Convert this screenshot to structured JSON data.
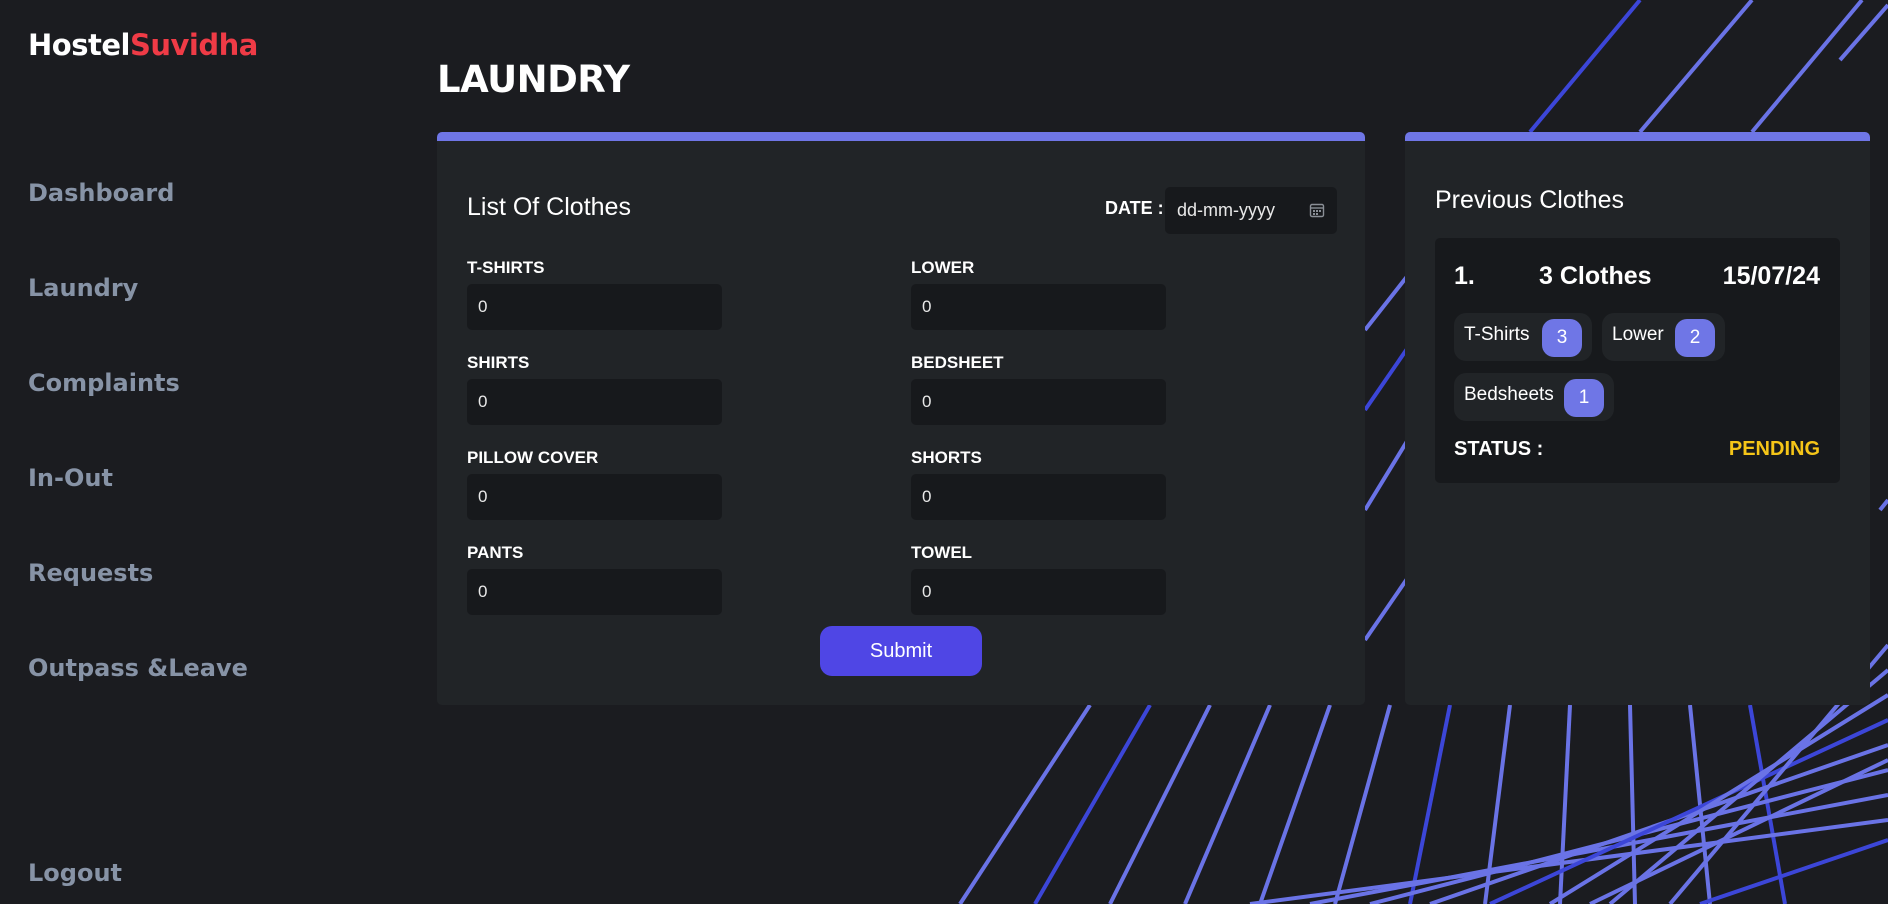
{
  "brand": {
    "part1": "Hostel",
    "part2": "Suvidha"
  },
  "nav": {
    "dashboard": "Dashboard",
    "laundry": "Laundry",
    "complaints": "Complaints",
    "in_out": "In-Out",
    "requests": "Requests",
    "outpass": "Outpass &Leave",
    "logout": "Logout"
  },
  "page_title": "LAUNDRY",
  "form": {
    "title": "List Of Clothes",
    "date_label": "DATE :",
    "date_placeholder": "dd-mm-yyyy",
    "fields": {
      "tshirts": {
        "label": "T-SHIRTS",
        "value": "0"
      },
      "lower": {
        "label": "LOWER",
        "value": "0"
      },
      "shirts": {
        "label": "SHIRTS",
        "value": "0"
      },
      "bedsheet": {
        "label": "BEDSHEET",
        "value": "0"
      },
      "pillow_cover": {
        "label": "PILLOW COVER",
        "value": "0"
      },
      "shorts": {
        "label": "SHORTS",
        "value": "0"
      },
      "pants": {
        "label": "PANTS",
        "value": "0"
      },
      "towel": {
        "label": "TOWEL",
        "value": "0"
      }
    },
    "submit_label": "Submit"
  },
  "previous": {
    "title": "Previous Clothes",
    "entry": {
      "index": "1.",
      "summary": "3 Clothes",
      "date": "15/07/24",
      "items": {
        "tshirts": {
          "label": "T-Shirts",
          "count": "3"
        },
        "lower": {
          "label": "Lower",
          "count": "2"
        },
        "bedsheets": {
          "label": "Bedsheets",
          "count": "1"
        }
      },
      "status_label": "STATUS :",
      "status_value": "PENDING"
    }
  },
  "colors": {
    "accent": "#6f76e6",
    "button": "#4f46e5",
    "brand_red": "#ef3b46",
    "status_pending": "#f5c518",
    "background": "#1b1c20",
    "card": "#212427"
  }
}
